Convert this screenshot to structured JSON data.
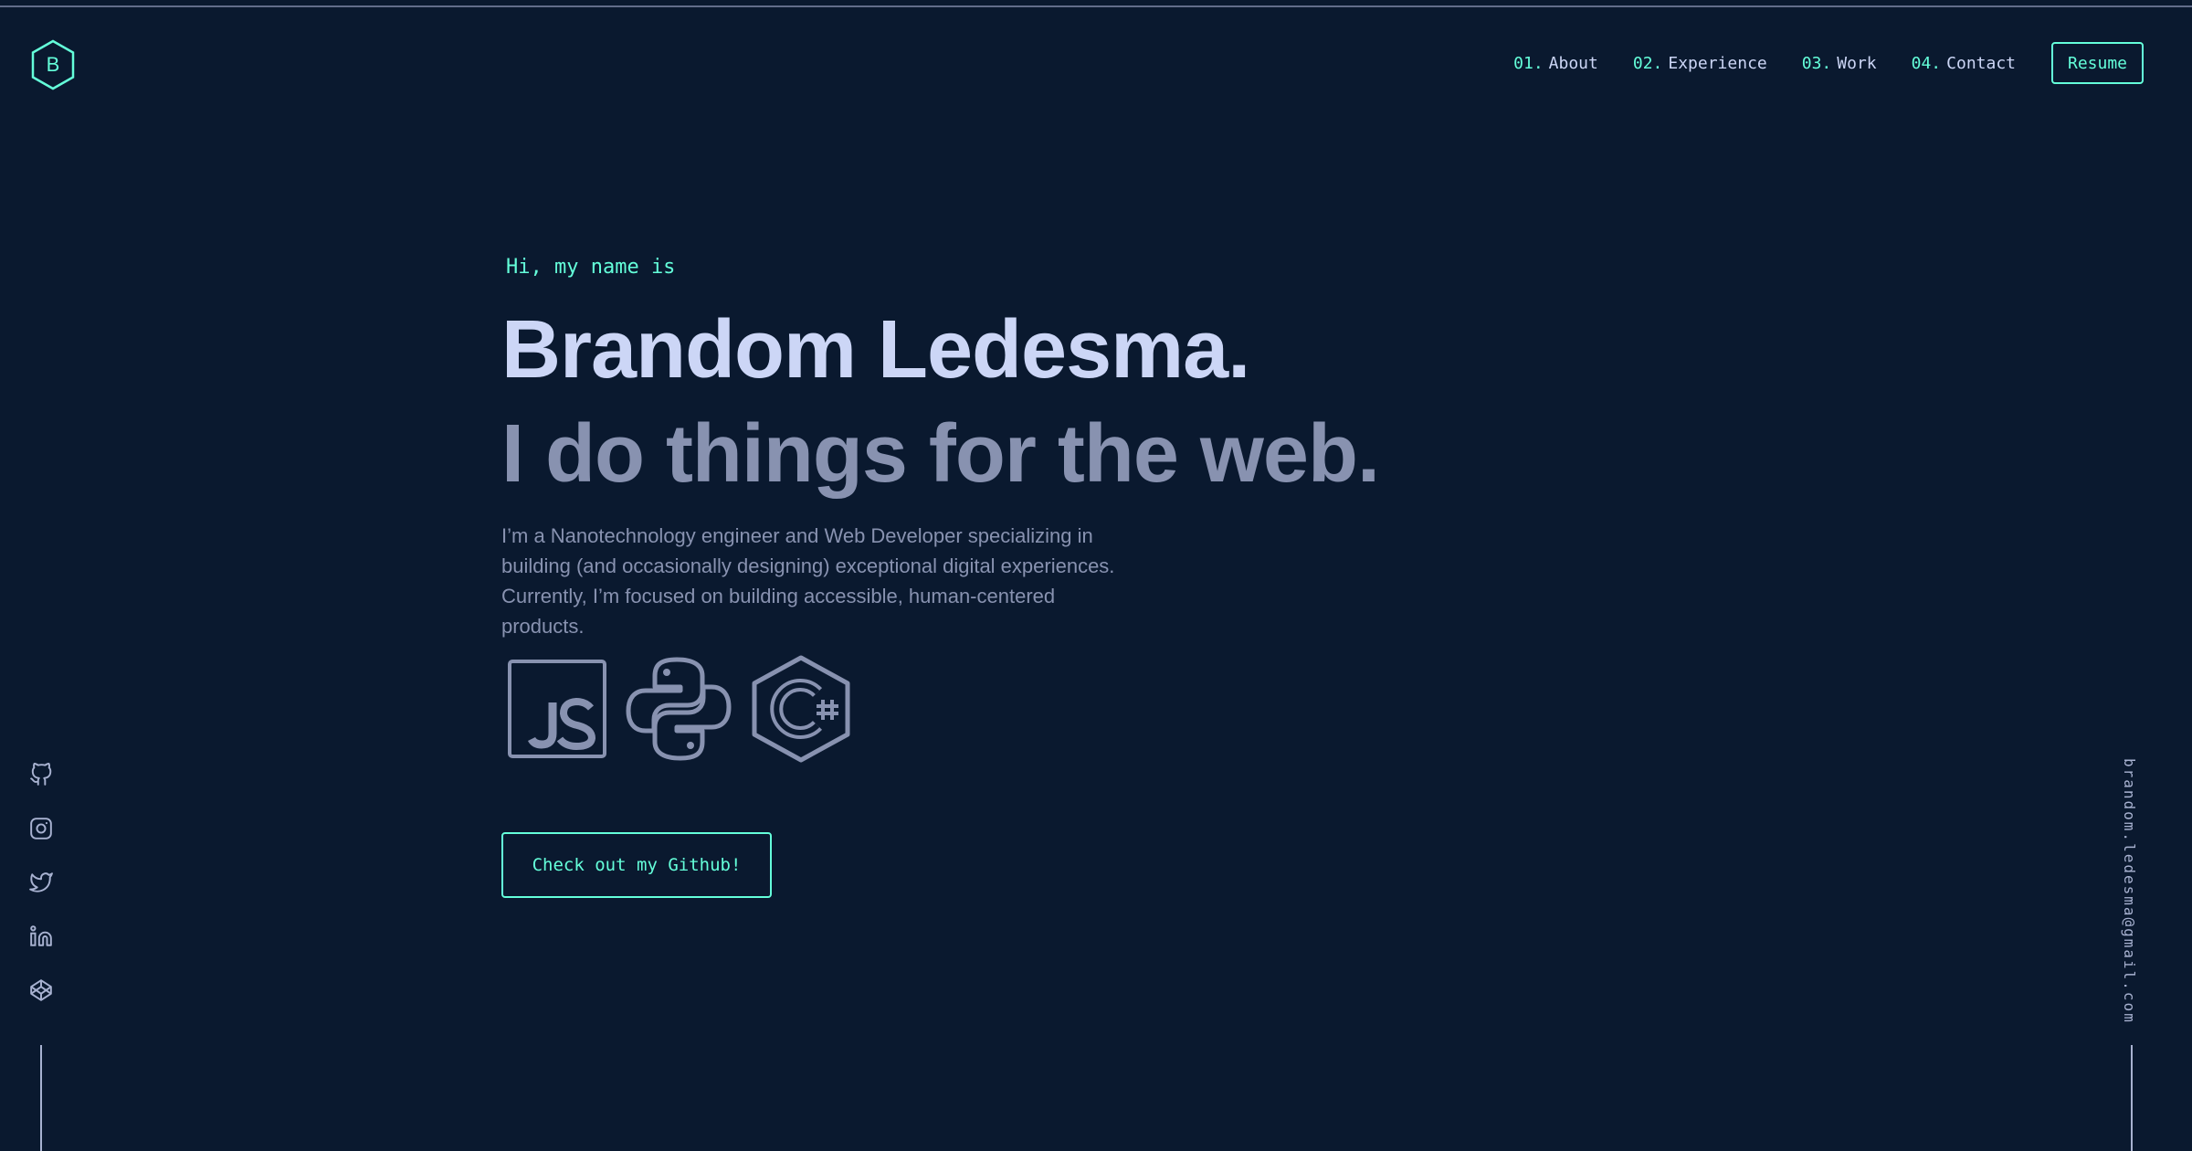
{
  "brand": {
    "logo_letter": "B",
    "logo_icon": "hexagon-logo-icon"
  },
  "nav": {
    "items": [
      {
        "number": "01.",
        "label": "About"
      },
      {
        "number": "02.",
        "label": "Experience"
      },
      {
        "number": "03.",
        "label": "Work"
      },
      {
        "number": "04.",
        "label": "Contact"
      }
    ],
    "resume_label": "Resume"
  },
  "hero": {
    "greeting": "Hi, my name is",
    "name": "Brandom Ledesma.",
    "tagline": "I do things for the web.",
    "bio": "I’m a Nanotechnology engineer and Web Developer specializing in building (and occasionally designing) exceptional digital experiences. Currently, I’m focused on building accessible, human-centered products.",
    "tech_icons": [
      "javascript-icon",
      "python-icon",
      "csharp-icon"
    ],
    "cta_label": "Check out my Github!"
  },
  "social": {
    "icons": [
      "github-icon",
      "instagram-icon",
      "twitter-icon",
      "linkedin-icon",
      "codepen-icon"
    ]
  },
  "email": "brandom.ledesma@gmail.com",
  "colors": {
    "background": "#0a192f",
    "accent": "#64ffda",
    "lightest_slate": "#ccd6f6",
    "slate": "#8892b0",
    "light_slate": "#a8b2d1"
  }
}
